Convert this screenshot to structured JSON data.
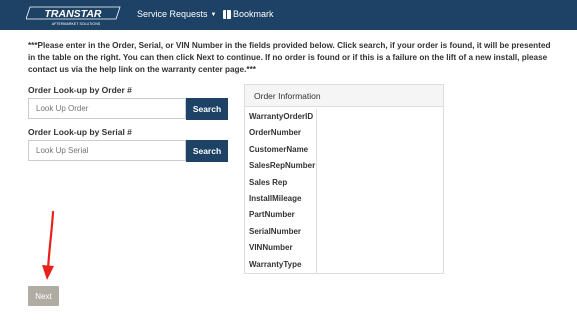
{
  "navbar": {
    "logo_text": "TRANSTAR",
    "logo_subtext": "AFTERMARKET SOLUTIONS",
    "service_requests_label": "Service Requests",
    "bookmark_label": "Bookmark"
  },
  "instructions": "***Please enter in the Order, Serial, or VIN Number in the fields provided below. Click search, if your order is found, it will be presented in the table on the right. You can then click Next to continue. If no order is found or if this is a failure on the lift of a new install, please contact us via the help link on the warranty center page.***",
  "order_lookup": {
    "label": "Order Look-up by Order #",
    "placeholder": "Look Up Order",
    "button": "Search"
  },
  "serial_lookup": {
    "label": "Order Look-up by Serial #",
    "placeholder": "Look Up Serial",
    "button": "Search"
  },
  "order_info": {
    "title": "Order Information",
    "fields": [
      "WarrantyOrderID",
      "OrderNumber",
      "CustomerName",
      "SalesRepNumber",
      "Sales Rep",
      "InstallMileage",
      "PartNumber",
      "SerialNumber",
      "VINNumber",
      "WarrantyType"
    ]
  },
  "next_button": "Next",
  "colors": {
    "navbar": "#1d4266",
    "search_button": "#1d4266",
    "next_button": "#b0aca4",
    "arrow": "#e8221b"
  }
}
